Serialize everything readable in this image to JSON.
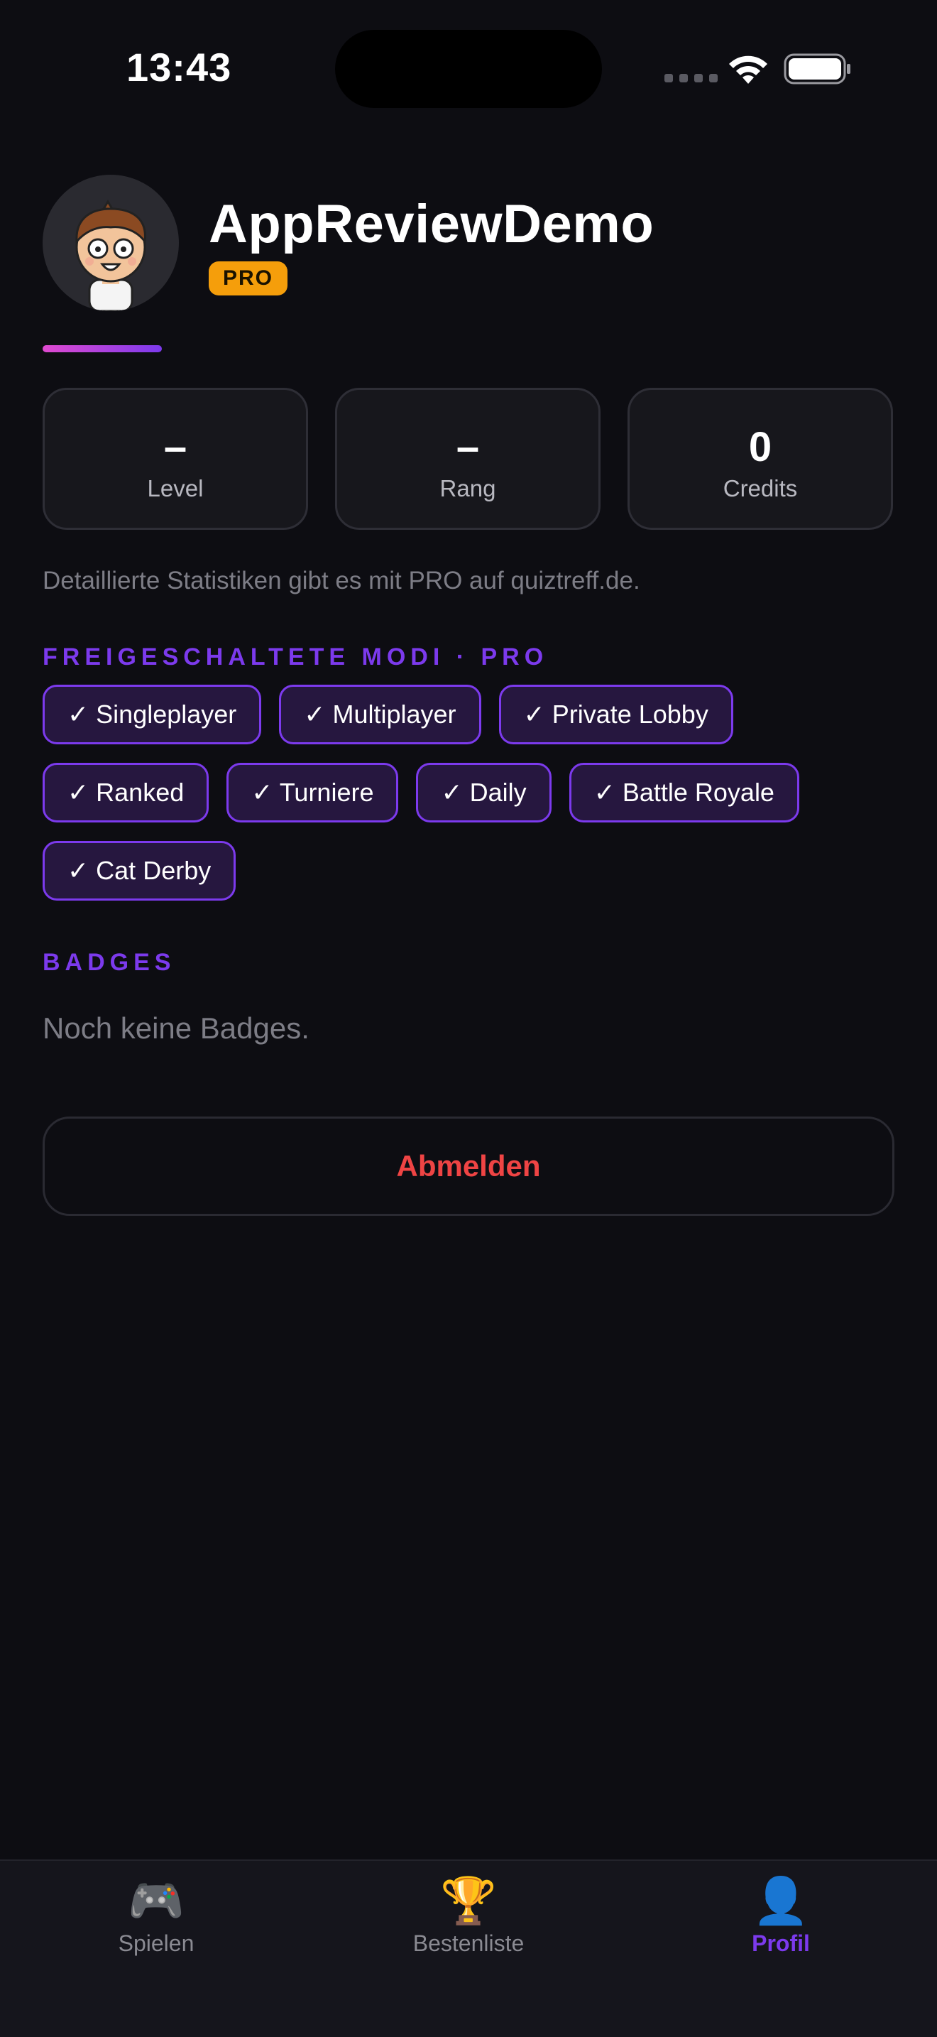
{
  "status_bar": {
    "time": "13:43"
  },
  "profile": {
    "username": "AppReviewDemo",
    "tier_badge": "PRO"
  },
  "stats": [
    {
      "value": "–",
      "label": "Level"
    },
    {
      "value": "–",
      "label": "Rang"
    },
    {
      "value": "0",
      "label": "Credits"
    }
  ],
  "stats_note": "Detaillierte Statistiken gibt es mit PRO auf quiztreff.de.",
  "modes": {
    "title": "FREIGESCHALTETE MODI · PRO",
    "items": [
      "✓ Singleplayer",
      "✓ Multiplayer",
      "✓ Private Lobby",
      "✓ Ranked",
      "✓ Turniere",
      "✓ Daily",
      "✓ Battle Royale",
      "✓ Cat Derby"
    ]
  },
  "badges": {
    "title": "BADGES",
    "empty_text": "Noch keine Badges."
  },
  "logout_label": "Abmelden",
  "tabs": [
    {
      "icon": "🎮",
      "icon_name": "gamepad-icon",
      "label": "Spielen"
    },
    {
      "icon": "🏆",
      "icon_name": "trophy-icon",
      "label": "Bestenliste"
    },
    {
      "icon": "👤",
      "icon_name": "profile-icon",
      "label": "Profil"
    }
  ],
  "colors": {
    "background": "#0d0d12",
    "accent": "#7c3aed",
    "pro_badge": "#f59e0b",
    "logout_text": "#ef4444"
  }
}
